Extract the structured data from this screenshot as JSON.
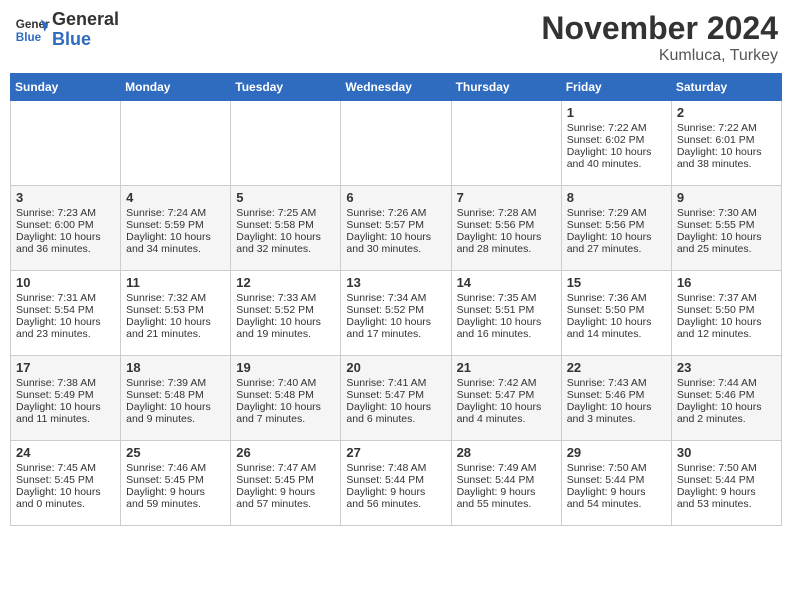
{
  "header": {
    "logo_line1": "General",
    "logo_line2": "Blue",
    "title": "November 2024",
    "subtitle": "Kumluca, Turkey"
  },
  "days_of_week": [
    "Sunday",
    "Monday",
    "Tuesday",
    "Wednesday",
    "Thursday",
    "Friday",
    "Saturday"
  ],
  "weeks": [
    [
      {
        "day": "",
        "info": ""
      },
      {
        "day": "",
        "info": ""
      },
      {
        "day": "",
        "info": ""
      },
      {
        "day": "",
        "info": ""
      },
      {
        "day": "",
        "info": ""
      },
      {
        "day": "1",
        "info": "Sunrise: 7:22 AM\nSunset: 6:02 PM\nDaylight: 10 hours and 40 minutes."
      },
      {
        "day": "2",
        "info": "Sunrise: 7:22 AM\nSunset: 6:01 PM\nDaylight: 10 hours and 38 minutes."
      }
    ],
    [
      {
        "day": "3",
        "info": "Sunrise: 7:23 AM\nSunset: 6:00 PM\nDaylight: 10 hours and 36 minutes."
      },
      {
        "day": "4",
        "info": "Sunrise: 7:24 AM\nSunset: 5:59 PM\nDaylight: 10 hours and 34 minutes."
      },
      {
        "day": "5",
        "info": "Sunrise: 7:25 AM\nSunset: 5:58 PM\nDaylight: 10 hours and 32 minutes."
      },
      {
        "day": "6",
        "info": "Sunrise: 7:26 AM\nSunset: 5:57 PM\nDaylight: 10 hours and 30 minutes."
      },
      {
        "day": "7",
        "info": "Sunrise: 7:28 AM\nSunset: 5:56 PM\nDaylight: 10 hours and 28 minutes."
      },
      {
        "day": "8",
        "info": "Sunrise: 7:29 AM\nSunset: 5:56 PM\nDaylight: 10 hours and 27 minutes."
      },
      {
        "day": "9",
        "info": "Sunrise: 7:30 AM\nSunset: 5:55 PM\nDaylight: 10 hours and 25 minutes."
      }
    ],
    [
      {
        "day": "10",
        "info": "Sunrise: 7:31 AM\nSunset: 5:54 PM\nDaylight: 10 hours and 23 minutes."
      },
      {
        "day": "11",
        "info": "Sunrise: 7:32 AM\nSunset: 5:53 PM\nDaylight: 10 hours and 21 minutes."
      },
      {
        "day": "12",
        "info": "Sunrise: 7:33 AM\nSunset: 5:52 PM\nDaylight: 10 hours and 19 minutes."
      },
      {
        "day": "13",
        "info": "Sunrise: 7:34 AM\nSunset: 5:52 PM\nDaylight: 10 hours and 17 minutes."
      },
      {
        "day": "14",
        "info": "Sunrise: 7:35 AM\nSunset: 5:51 PM\nDaylight: 10 hours and 16 minutes."
      },
      {
        "day": "15",
        "info": "Sunrise: 7:36 AM\nSunset: 5:50 PM\nDaylight: 10 hours and 14 minutes."
      },
      {
        "day": "16",
        "info": "Sunrise: 7:37 AM\nSunset: 5:50 PM\nDaylight: 10 hours and 12 minutes."
      }
    ],
    [
      {
        "day": "17",
        "info": "Sunrise: 7:38 AM\nSunset: 5:49 PM\nDaylight: 10 hours and 11 minutes."
      },
      {
        "day": "18",
        "info": "Sunrise: 7:39 AM\nSunset: 5:48 PM\nDaylight: 10 hours and 9 minutes."
      },
      {
        "day": "19",
        "info": "Sunrise: 7:40 AM\nSunset: 5:48 PM\nDaylight: 10 hours and 7 minutes."
      },
      {
        "day": "20",
        "info": "Sunrise: 7:41 AM\nSunset: 5:47 PM\nDaylight: 10 hours and 6 minutes."
      },
      {
        "day": "21",
        "info": "Sunrise: 7:42 AM\nSunset: 5:47 PM\nDaylight: 10 hours and 4 minutes."
      },
      {
        "day": "22",
        "info": "Sunrise: 7:43 AM\nSunset: 5:46 PM\nDaylight: 10 hours and 3 minutes."
      },
      {
        "day": "23",
        "info": "Sunrise: 7:44 AM\nSunset: 5:46 PM\nDaylight: 10 hours and 2 minutes."
      }
    ],
    [
      {
        "day": "24",
        "info": "Sunrise: 7:45 AM\nSunset: 5:45 PM\nDaylight: 10 hours and 0 minutes."
      },
      {
        "day": "25",
        "info": "Sunrise: 7:46 AM\nSunset: 5:45 PM\nDaylight: 9 hours and 59 minutes."
      },
      {
        "day": "26",
        "info": "Sunrise: 7:47 AM\nSunset: 5:45 PM\nDaylight: 9 hours and 57 minutes."
      },
      {
        "day": "27",
        "info": "Sunrise: 7:48 AM\nSunset: 5:44 PM\nDaylight: 9 hours and 56 minutes."
      },
      {
        "day": "28",
        "info": "Sunrise: 7:49 AM\nSunset: 5:44 PM\nDaylight: 9 hours and 55 minutes."
      },
      {
        "day": "29",
        "info": "Sunrise: 7:50 AM\nSunset: 5:44 PM\nDaylight: 9 hours and 54 minutes."
      },
      {
        "day": "30",
        "info": "Sunrise: 7:50 AM\nSunset: 5:44 PM\nDaylight: 9 hours and 53 minutes."
      }
    ]
  ]
}
